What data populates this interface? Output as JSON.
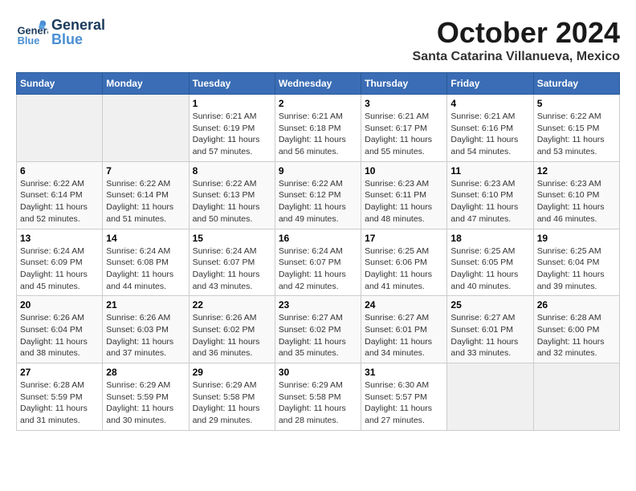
{
  "header": {
    "logo": {
      "general": "General",
      "blue": "Blue"
    },
    "month": "October 2024",
    "location": "Santa Catarina Villanueva, Mexico"
  },
  "weekdays": [
    "Sunday",
    "Monday",
    "Tuesday",
    "Wednesday",
    "Thursday",
    "Friday",
    "Saturday"
  ],
  "weeks": [
    [
      {
        "day": "",
        "sunrise": "",
        "sunset": "",
        "daylight": ""
      },
      {
        "day": "",
        "sunrise": "",
        "sunset": "",
        "daylight": ""
      },
      {
        "day": "1",
        "sunrise": "Sunrise: 6:21 AM",
        "sunset": "Sunset: 6:19 PM",
        "daylight": "Daylight: 11 hours and 57 minutes."
      },
      {
        "day": "2",
        "sunrise": "Sunrise: 6:21 AM",
        "sunset": "Sunset: 6:18 PM",
        "daylight": "Daylight: 11 hours and 56 minutes."
      },
      {
        "day": "3",
        "sunrise": "Sunrise: 6:21 AM",
        "sunset": "Sunset: 6:17 PM",
        "daylight": "Daylight: 11 hours and 55 minutes."
      },
      {
        "day": "4",
        "sunrise": "Sunrise: 6:21 AM",
        "sunset": "Sunset: 6:16 PM",
        "daylight": "Daylight: 11 hours and 54 minutes."
      },
      {
        "day": "5",
        "sunrise": "Sunrise: 6:22 AM",
        "sunset": "Sunset: 6:15 PM",
        "daylight": "Daylight: 11 hours and 53 minutes."
      }
    ],
    [
      {
        "day": "6",
        "sunrise": "Sunrise: 6:22 AM",
        "sunset": "Sunset: 6:14 PM",
        "daylight": "Daylight: 11 hours and 52 minutes."
      },
      {
        "day": "7",
        "sunrise": "Sunrise: 6:22 AM",
        "sunset": "Sunset: 6:14 PM",
        "daylight": "Daylight: 11 hours and 51 minutes."
      },
      {
        "day": "8",
        "sunrise": "Sunrise: 6:22 AM",
        "sunset": "Sunset: 6:13 PM",
        "daylight": "Daylight: 11 hours and 50 minutes."
      },
      {
        "day": "9",
        "sunrise": "Sunrise: 6:22 AM",
        "sunset": "Sunset: 6:12 PM",
        "daylight": "Daylight: 11 hours and 49 minutes."
      },
      {
        "day": "10",
        "sunrise": "Sunrise: 6:23 AM",
        "sunset": "Sunset: 6:11 PM",
        "daylight": "Daylight: 11 hours and 48 minutes."
      },
      {
        "day": "11",
        "sunrise": "Sunrise: 6:23 AM",
        "sunset": "Sunset: 6:10 PM",
        "daylight": "Daylight: 11 hours and 47 minutes."
      },
      {
        "day": "12",
        "sunrise": "Sunrise: 6:23 AM",
        "sunset": "Sunset: 6:10 PM",
        "daylight": "Daylight: 11 hours and 46 minutes."
      }
    ],
    [
      {
        "day": "13",
        "sunrise": "Sunrise: 6:24 AM",
        "sunset": "Sunset: 6:09 PM",
        "daylight": "Daylight: 11 hours and 45 minutes."
      },
      {
        "day": "14",
        "sunrise": "Sunrise: 6:24 AM",
        "sunset": "Sunset: 6:08 PM",
        "daylight": "Daylight: 11 hours and 44 minutes."
      },
      {
        "day": "15",
        "sunrise": "Sunrise: 6:24 AM",
        "sunset": "Sunset: 6:07 PM",
        "daylight": "Daylight: 11 hours and 43 minutes."
      },
      {
        "day": "16",
        "sunrise": "Sunrise: 6:24 AM",
        "sunset": "Sunset: 6:07 PM",
        "daylight": "Daylight: 11 hours and 42 minutes."
      },
      {
        "day": "17",
        "sunrise": "Sunrise: 6:25 AM",
        "sunset": "Sunset: 6:06 PM",
        "daylight": "Daylight: 11 hours and 41 minutes."
      },
      {
        "day": "18",
        "sunrise": "Sunrise: 6:25 AM",
        "sunset": "Sunset: 6:05 PM",
        "daylight": "Daylight: 11 hours and 40 minutes."
      },
      {
        "day": "19",
        "sunrise": "Sunrise: 6:25 AM",
        "sunset": "Sunset: 6:04 PM",
        "daylight": "Daylight: 11 hours and 39 minutes."
      }
    ],
    [
      {
        "day": "20",
        "sunrise": "Sunrise: 6:26 AM",
        "sunset": "Sunset: 6:04 PM",
        "daylight": "Daylight: 11 hours and 38 minutes."
      },
      {
        "day": "21",
        "sunrise": "Sunrise: 6:26 AM",
        "sunset": "Sunset: 6:03 PM",
        "daylight": "Daylight: 11 hours and 37 minutes."
      },
      {
        "day": "22",
        "sunrise": "Sunrise: 6:26 AM",
        "sunset": "Sunset: 6:02 PM",
        "daylight": "Daylight: 11 hours and 36 minutes."
      },
      {
        "day": "23",
        "sunrise": "Sunrise: 6:27 AM",
        "sunset": "Sunset: 6:02 PM",
        "daylight": "Daylight: 11 hours and 35 minutes."
      },
      {
        "day": "24",
        "sunrise": "Sunrise: 6:27 AM",
        "sunset": "Sunset: 6:01 PM",
        "daylight": "Daylight: 11 hours and 34 minutes."
      },
      {
        "day": "25",
        "sunrise": "Sunrise: 6:27 AM",
        "sunset": "Sunset: 6:01 PM",
        "daylight": "Daylight: 11 hours and 33 minutes."
      },
      {
        "day": "26",
        "sunrise": "Sunrise: 6:28 AM",
        "sunset": "Sunset: 6:00 PM",
        "daylight": "Daylight: 11 hours and 32 minutes."
      }
    ],
    [
      {
        "day": "27",
        "sunrise": "Sunrise: 6:28 AM",
        "sunset": "Sunset: 5:59 PM",
        "daylight": "Daylight: 11 hours and 31 minutes."
      },
      {
        "day": "28",
        "sunrise": "Sunrise: 6:29 AM",
        "sunset": "Sunset: 5:59 PM",
        "daylight": "Daylight: 11 hours and 30 minutes."
      },
      {
        "day": "29",
        "sunrise": "Sunrise: 6:29 AM",
        "sunset": "Sunset: 5:58 PM",
        "daylight": "Daylight: 11 hours and 29 minutes."
      },
      {
        "day": "30",
        "sunrise": "Sunrise: 6:29 AM",
        "sunset": "Sunset: 5:58 PM",
        "daylight": "Daylight: 11 hours and 28 minutes."
      },
      {
        "day": "31",
        "sunrise": "Sunrise: 6:30 AM",
        "sunset": "Sunset: 5:57 PM",
        "daylight": "Daylight: 11 hours and 27 minutes."
      },
      {
        "day": "",
        "sunrise": "",
        "sunset": "",
        "daylight": ""
      },
      {
        "day": "",
        "sunrise": "",
        "sunset": "",
        "daylight": ""
      }
    ]
  ]
}
